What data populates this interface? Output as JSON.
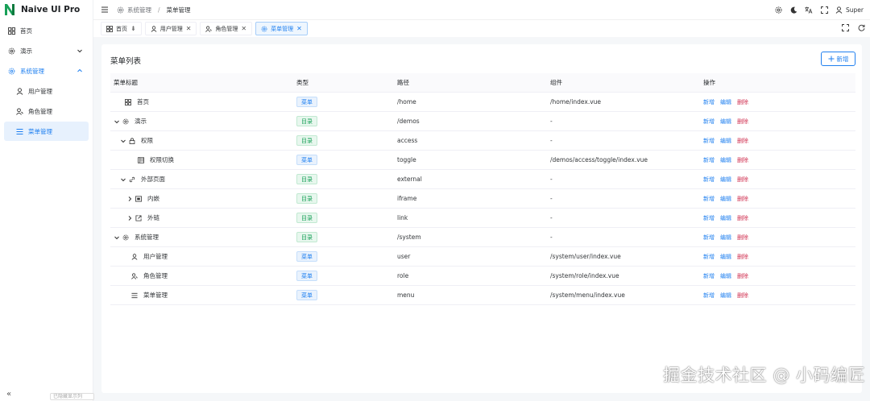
{
  "app": {
    "title": "Naive UI Pro",
    "brand_color": "#18a058",
    "accent": "#2080f0"
  },
  "sidebar": {
    "items": [
      {
        "label": "首页",
        "icon": "dashboard-icon"
      },
      {
        "label": "演示",
        "icon": "gear-icon"
      },
      {
        "label": "系统管理",
        "icon": "gear-icon"
      },
      {
        "label": "用户管理",
        "icon": "user-icon"
      },
      {
        "label": "角色管理",
        "icon": "role-icon"
      },
      {
        "label": "菜单管理",
        "icon": "menu-list-icon"
      }
    ],
    "collapse": "«",
    "bottom_input": "已隐藏显示列"
  },
  "header": {
    "breadcrumb": [
      "系统管理",
      "菜单管理"
    ],
    "breadcrumb_sep": "/",
    "user": "Super"
  },
  "tabs": [
    {
      "label": "首页",
      "suffix": "⇟"
    },
    {
      "label": "用户管理",
      "suffix": "✕"
    },
    {
      "label": "角色管理",
      "suffix": "✕"
    },
    {
      "label": "菜单管理",
      "suffix": "✕"
    }
  ],
  "page": {
    "title": "菜单列表",
    "add_button": "新增"
  },
  "table": {
    "columns": [
      "菜单标题",
      "类型",
      "路径",
      "组件",
      "操作"
    ],
    "ops": [
      "新增",
      "编辑",
      "删除"
    ],
    "rows": [
      {
        "title": "首页",
        "type": "菜单",
        "path": "/home",
        "component": "/home/index.vue"
      },
      {
        "title": "演示",
        "type": "目录",
        "path": "/demos",
        "component": "-"
      },
      {
        "title": "权限",
        "type": "目录",
        "path": "access",
        "component": "-"
      },
      {
        "title": "权限切换",
        "type": "菜单",
        "path": "toggle",
        "component": "/demos/access/toggle/index.vue"
      },
      {
        "title": "外部页面",
        "type": "目录",
        "path": "external",
        "component": "-"
      },
      {
        "title": "内嵌",
        "type": "目录",
        "path": "iframe",
        "component": "-"
      },
      {
        "title": "外链",
        "type": "目录",
        "path": "link",
        "component": "-"
      },
      {
        "title": "系统管理",
        "type": "目录",
        "path": "/system",
        "component": "-"
      },
      {
        "title": "用户管理",
        "type": "菜单",
        "path": "user",
        "component": "/system/user/index.vue"
      },
      {
        "title": "角色管理",
        "type": "菜单",
        "path": "role",
        "component": "/system/role/index.vue"
      },
      {
        "title": "菜单管理",
        "type": "菜单",
        "path": "menu",
        "component": "/system/menu/index.vue"
      }
    ]
  },
  "watermark": "掘金技术社区 @ 小码编匠"
}
